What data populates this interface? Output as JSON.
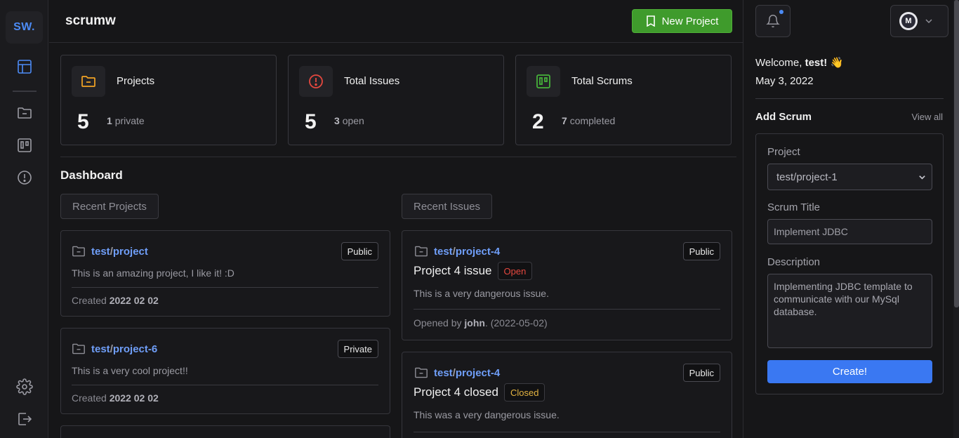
{
  "sidebar": {
    "logo": "SW.",
    "icons": [
      "dashboard-icon",
      "folder-icon",
      "board-icon",
      "alert-icon",
      "gear-icon",
      "logout-icon"
    ]
  },
  "header": {
    "brand": "scrumw",
    "new_project_label": "New Project"
  },
  "stats": [
    {
      "label": "Projects",
      "count": "5",
      "sub_count": "1",
      "sub_text": "private",
      "icon": "folder-icon",
      "color": "#f5a524"
    },
    {
      "label": "Total Issues",
      "count": "5",
      "sub_count": "3",
      "sub_text": "open",
      "icon": "alert-circle-icon",
      "color": "#e5483f"
    },
    {
      "label": "Total Scrums",
      "count": "2",
      "sub_count": "7",
      "sub_text": "completed",
      "icon": "board-icon",
      "color": "#46b13a"
    }
  ],
  "dashboard": {
    "title": "Dashboard",
    "recent_projects_label": "Recent Projects",
    "recent_issues_label": "Recent Issues",
    "projects": [
      {
        "owner": "test",
        "name": "project",
        "visibility": "Public",
        "description": "This is an amazing project, I like it! :D",
        "created_prefix": "Created",
        "created": "2022 02 02"
      },
      {
        "owner": "test",
        "name": "project-6",
        "visibility": "Private",
        "description": "This is a very cool project!!",
        "created_prefix": "Created",
        "created": "2022 02 02"
      }
    ],
    "issues": [
      {
        "owner": "test",
        "name": "project-4",
        "visibility": "Public",
        "title": "Project 4 issue",
        "status": "Open",
        "description": "This is a very dangerous issue.",
        "opened_prefix": "Opened by",
        "user": "john",
        "date": ". (2022-05-02)"
      },
      {
        "owner": "test",
        "name": "project-4",
        "visibility": "Public",
        "title": "Project 4 closed",
        "status": "Closed",
        "description": "This was a very dangerous issue."
      }
    ]
  },
  "right_panel": {
    "welcome_prefix": "Welcome,",
    "username": "test!",
    "wave": "👋",
    "date": "May 3, 2022",
    "add_scrum_title": "Add Scrum",
    "view_all": "View all",
    "form": {
      "project_label": "Project",
      "project_value": "test/project-1",
      "title_label": "Scrum Title",
      "title_placeholder": "Implement JDBC",
      "description_label": "Description",
      "description_placeholder": "Implementing JDBC template to communicate with our MySql database.",
      "submit_label": "Create!"
    }
  }
}
